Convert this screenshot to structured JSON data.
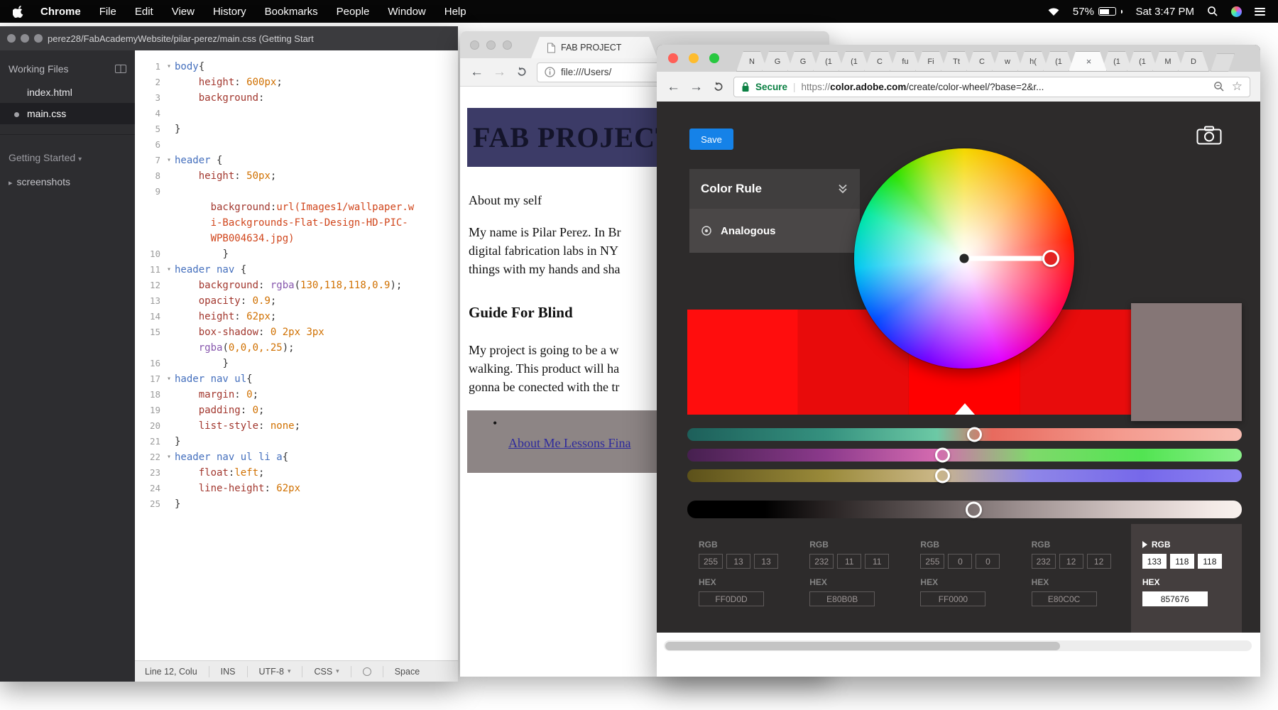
{
  "menubar": {
    "app": "Chrome",
    "items": [
      "File",
      "Edit",
      "View",
      "History",
      "Bookmarks",
      "People",
      "Window",
      "Help"
    ],
    "battery": "57%",
    "clock": "Sat 3:47 PM",
    "icons": [
      "apple-icon",
      "wifi-icon",
      "battery-icon",
      "search-icon",
      "siri-icon",
      "list-icon"
    ]
  },
  "editor": {
    "titlebar": "perez28/FabAcademyWebsite/pilar-perez/main.css (Getting Start",
    "sidebar": {
      "working_files_label": "Working Files",
      "files": [
        {
          "name": "index.html",
          "active": false
        },
        {
          "name": "main.css",
          "active": true
        }
      ],
      "section_label": "Getting Started",
      "folder_label": "screenshots"
    },
    "code_rows": [
      {
        "n": "1",
        "fold": true,
        "segs": [
          [
            "body",
            "sel"
          ],
          [
            "{",
            "pl"
          ]
        ]
      },
      {
        "n": "2",
        "segs": [
          [
            "    ",
            "pl"
          ],
          [
            "height",
            "prop"
          ],
          [
            ": ",
            "pl"
          ],
          [
            "600px",
            "val"
          ],
          [
            ";",
            "pl"
          ]
        ]
      },
      {
        "n": "3",
        "segs": [
          [
            "    ",
            "pl"
          ],
          [
            "background",
            "prop"
          ],
          [
            ":",
            "pl"
          ]
        ]
      },
      {
        "n": "4",
        "segs": []
      },
      {
        "n": "5",
        "segs": [
          [
            "}",
            "pl"
          ]
        ]
      },
      {
        "n": "6",
        "segs": []
      },
      {
        "n": "7",
        "fold": true,
        "segs": [
          [
            "header",
            "sel"
          ],
          [
            " {",
            "pl"
          ]
        ]
      },
      {
        "n": "8",
        "segs": [
          [
            "    ",
            "pl"
          ],
          [
            "height",
            "prop"
          ],
          [
            ": ",
            "pl"
          ],
          [
            "50px",
            "val"
          ],
          [
            ";",
            "pl"
          ]
        ]
      },
      {
        "n": "9",
        "segs": []
      },
      {
        "n": "",
        "segs": [
          [
            "      ",
            "pl"
          ],
          [
            "background",
            "prop"
          ],
          [
            ":",
            "pl"
          ],
          [
            "url(Images1/wallpaper.w",
            "str"
          ]
        ]
      },
      {
        "n": "",
        "segs": [
          [
            "      ",
            "pl"
          ],
          [
            "i-Backgrounds-Flat-Design-HD-PIC-",
            "str"
          ]
        ]
      },
      {
        "n": "",
        "segs": [
          [
            "      ",
            "pl"
          ],
          [
            "WPB004634.jpg)",
            "str"
          ]
        ]
      },
      {
        "n": "10",
        "segs": [
          [
            "        ",
            "pl"
          ],
          [
            "}",
            "pl"
          ]
        ]
      },
      {
        "n": "11",
        "fold": true,
        "segs": [
          [
            "header nav",
            "sel"
          ],
          [
            " {",
            "pl"
          ]
        ]
      },
      {
        "n": "12",
        "segs": [
          [
            "    ",
            "pl"
          ],
          [
            "background",
            "prop"
          ],
          [
            ": ",
            "pl"
          ],
          [
            "rgba",
            "fn"
          ],
          [
            "(",
            "pl"
          ],
          [
            "130,118,118,0.9",
            "val"
          ],
          [
            ");",
            "pl"
          ]
        ]
      },
      {
        "n": "13",
        "segs": [
          [
            "    ",
            "pl"
          ],
          [
            "opacity",
            "prop"
          ],
          [
            ": ",
            "pl"
          ],
          [
            "0.9",
            "val"
          ],
          [
            ";",
            "pl"
          ]
        ]
      },
      {
        "n": "14",
        "segs": [
          [
            "    ",
            "pl"
          ],
          [
            "height",
            "prop"
          ],
          [
            ": ",
            "pl"
          ],
          [
            "62px",
            "val"
          ],
          [
            ";",
            "pl"
          ]
        ]
      },
      {
        "n": "15",
        "segs": [
          [
            "    ",
            "pl"
          ],
          [
            "box-shadow",
            "prop"
          ],
          [
            ": ",
            "pl"
          ],
          [
            "0 2px 3px",
            "val"
          ]
        ]
      },
      {
        "n": "",
        "segs": [
          [
            "    ",
            "pl"
          ],
          [
            "rgba",
            "fn"
          ],
          [
            "(",
            "pl"
          ],
          [
            "0,0,0,.25",
            "val"
          ],
          [
            ");",
            "pl"
          ]
        ]
      },
      {
        "n": "16",
        "segs": [
          [
            "        ",
            "pl"
          ],
          [
            "}",
            "pl"
          ]
        ]
      },
      {
        "n": "17",
        "fold": true,
        "segs": [
          [
            "hader nav ul",
            "sel"
          ],
          [
            "{",
            "pl"
          ]
        ]
      },
      {
        "n": "18",
        "segs": [
          [
            "    ",
            "pl"
          ],
          [
            "margin",
            "prop"
          ],
          [
            ": ",
            "pl"
          ],
          [
            "0",
            "val"
          ],
          [
            ";",
            "pl"
          ]
        ]
      },
      {
        "n": "19",
        "segs": [
          [
            "    ",
            "pl"
          ],
          [
            "padding",
            "prop"
          ],
          [
            ": ",
            "pl"
          ],
          [
            "0",
            "val"
          ],
          [
            ";",
            "pl"
          ]
        ]
      },
      {
        "n": "20",
        "segs": [
          [
            "    ",
            "pl"
          ],
          [
            "list-style",
            "prop"
          ],
          [
            ": ",
            "pl"
          ],
          [
            "none",
            "val"
          ],
          [
            ";",
            "pl"
          ]
        ]
      },
      {
        "n": "21",
        "segs": [
          [
            "}",
            "pl"
          ]
        ]
      },
      {
        "n": "22",
        "fold": true,
        "segs": [
          [
            "header nav ul li a",
            "sel"
          ],
          [
            "{",
            "pl"
          ]
        ]
      },
      {
        "n": "23",
        "segs": [
          [
            "    ",
            "pl"
          ],
          [
            "float",
            "prop"
          ],
          [
            ":",
            "pl"
          ],
          [
            "left",
            "val"
          ],
          [
            ";",
            "pl"
          ]
        ]
      },
      {
        "n": "24",
        "segs": [
          [
            "    ",
            "pl"
          ],
          [
            "line-height",
            "prop"
          ],
          [
            ": ",
            "pl"
          ],
          [
            "62px",
            "val"
          ]
        ]
      },
      {
        "n": "25",
        "segs": [
          [
            "}",
            "pl"
          ]
        ]
      }
    ],
    "statusbar": [
      {
        "t": "Line 12, Colu"
      },
      {
        "t": "INS"
      },
      {
        "t": "UTF-8",
        "caret": true
      },
      {
        "t": "CSS",
        "caret": true
      },
      {
        "t": "",
        "circle": true
      },
      {
        "t": "Space"
      }
    ]
  },
  "fab": {
    "tab_title": "FAB PROJECT",
    "url": "file:///Users/",
    "page": {
      "banner": "FAB PROJECT",
      "about_heading": "About my self",
      "about_lines": [
        "My name is Pilar Perez. In Br",
        "digital fabrication labs in NY",
        "things with my hands and sha"
      ],
      "guide_heading": "Guide For Blind",
      "guide_lines": [
        "My project is going to be a w",
        "walking. This product will ha",
        "gonna be conected with the tr"
      ],
      "bullet": "•",
      "link_text": "About Me Lessons Fina"
    }
  },
  "adobe": {
    "tabs": [
      {
        "label": "N"
      },
      {
        "label": "G"
      },
      {
        "label": "G"
      },
      {
        "label": "(1"
      },
      {
        "label": "(1"
      },
      {
        "label": "C"
      },
      {
        "label": "fu"
      },
      {
        "label": "Fi"
      },
      {
        "label": "Tt"
      },
      {
        "label": "C"
      },
      {
        "label": "w"
      },
      {
        "label": "h("
      },
      {
        "label": "(1"
      },
      {
        "label": "",
        "active": true
      },
      {
        "label": "(1"
      },
      {
        "label": "(1"
      },
      {
        "label": "M"
      },
      {
        "label": "D"
      }
    ],
    "secure_label": "Secure",
    "url": {
      "scheme": "https://",
      "domain": "color.adobe.com",
      "path": "/create/color-wheel/?base=2&r..."
    },
    "save_label": "Save",
    "color_rule_label": "Color Rule",
    "rule_selected": "Analogous",
    "swatches": [
      "#FF0D0D",
      "#E80B0B",
      "#FF0000",
      "#E80C0C",
      "#857676"
    ],
    "selected_swatch_index": 4,
    "marker_index": 2,
    "rgb_label": "RGB",
    "hex_label": "HEX",
    "columns": [
      {
        "r": "255",
        "g": "13",
        "b": "13",
        "hex": "FF0D0D",
        "selected": false
      },
      {
        "r": "232",
        "g": "11",
        "b": "11",
        "hex": "E80B0B",
        "selected": false
      },
      {
        "r": "255",
        "g": "0",
        "b": "0",
        "hex": "FF0000",
        "selected": false
      },
      {
        "r": "232",
        "g": "12",
        "b": "12",
        "hex": "E80C0C",
        "selected": false
      },
      {
        "r": "133",
        "g": "118",
        "b": "118",
        "hex": "857676",
        "selected": true
      }
    ]
  }
}
